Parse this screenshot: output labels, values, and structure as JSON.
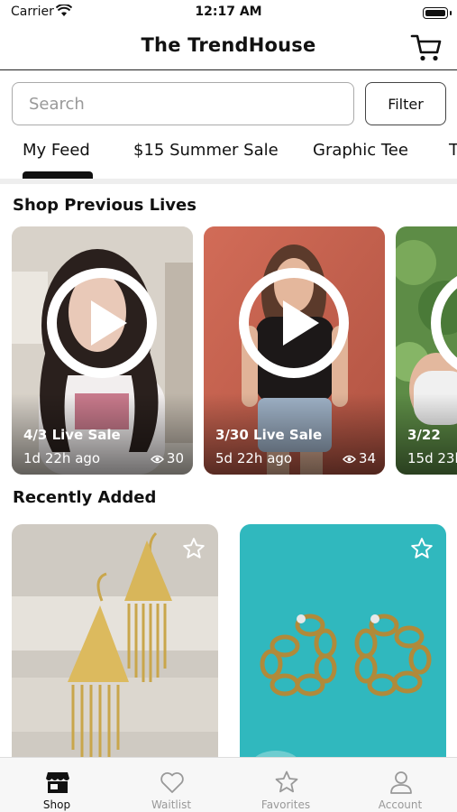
{
  "status_bar": {
    "carrier": "Carrier",
    "time": "12:17 AM"
  },
  "header": {
    "title": "The TrendHouse",
    "cart_icon": "cart-icon"
  },
  "search": {
    "placeholder": "Search",
    "filter_label": "Filter"
  },
  "tabs": [
    {
      "label": "My Feed",
      "active": true
    },
    {
      "label": "$15 Summer Sale",
      "active": false
    },
    {
      "label": "Graphic Tee",
      "active": false
    },
    {
      "label": "T",
      "active": false
    }
  ],
  "sections": {
    "lives_title": "Shop Previous Lives",
    "recent_title": "Recently Added"
  },
  "lives": [
    {
      "title": "4/3 Live Sale",
      "ago": "1d 22h ago",
      "views": "30"
    },
    {
      "title": "3/30 Live Sale",
      "ago": "5d 22h ago",
      "views": "34"
    },
    {
      "title": "3/22",
      "ago": "15d 23h",
      "views": ""
    }
  ],
  "products": [
    {
      "icon": "star-icon",
      "favorited": false
    },
    {
      "icon": "star-icon",
      "favorited": false
    }
  ],
  "tabbar": [
    {
      "label": "Shop",
      "icon": "shop-icon",
      "active": true
    },
    {
      "label": "Waitlist",
      "icon": "heart-icon",
      "active": false
    },
    {
      "label": "Favorites",
      "icon": "star-icon",
      "active": false
    },
    {
      "label": "Account",
      "icon": "person-icon",
      "active": false
    }
  ],
  "colors": {
    "accent": "#111111",
    "inactive": "#999999",
    "divider": "#eeeeee",
    "teal_bg": "#2bb3bb"
  }
}
